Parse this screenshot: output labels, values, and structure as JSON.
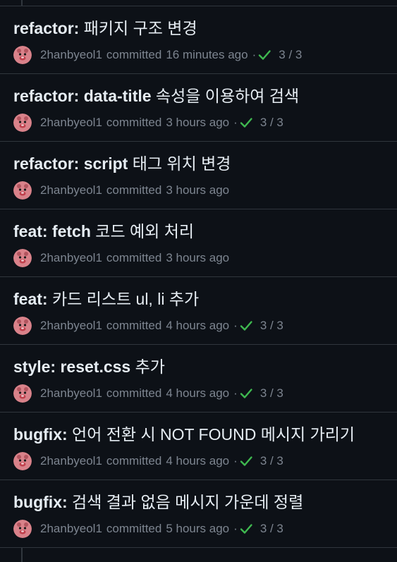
{
  "colors": {
    "background": "#0d1117",
    "border": "#30363d",
    "title_text": "#e6edf3",
    "meta_text": "#7d8590",
    "check_green": "#3fb950"
  },
  "commits": [
    {
      "prefix": "refactor:",
      "message": " 패키지 구조 변경",
      "author": "2hanbyeol1",
      "verb": "committed",
      "time": "16 minutes ago",
      "status": "3 / 3"
    },
    {
      "prefix": "refactor: data-title",
      "message": " 속성을 이용하여 검색",
      "author": "2hanbyeol1",
      "verb": "committed",
      "time": "3 hours ago",
      "status": "3 / 3"
    },
    {
      "prefix": "refactor: script",
      "message": " 태그 위치 변경",
      "author": "2hanbyeol1",
      "verb": "committed",
      "time": "3 hours ago",
      "status": ""
    },
    {
      "prefix": "feat: fetch",
      "message": " 코드 예외 처리",
      "author": "2hanbyeol1",
      "verb": "committed",
      "time": "3 hours ago",
      "status": ""
    },
    {
      "prefix": "feat:",
      "message": " 카드 리스트 ul, li 추가",
      "author": "2hanbyeol1",
      "verb": "committed",
      "time": "4 hours ago",
      "status": "3 / 3"
    },
    {
      "prefix": "style: reset.css",
      "message": " 추가",
      "author": "2hanbyeol1",
      "verb": "committed",
      "time": "4 hours ago",
      "status": "3 / 3"
    },
    {
      "prefix": "bugfix:",
      "message": " 언어 전환 시 NOT FOUND 메시지 가리기",
      "author": "2hanbyeol1",
      "verb": "committed",
      "time": "4 hours ago",
      "status": "3 / 3"
    },
    {
      "prefix": "bugfix:",
      "message": " 검색 결과 없음 메시지 가운데 정렬",
      "author": "2hanbyeol1",
      "verb": "committed",
      "time": "5 hours ago",
      "status": "3 / 3"
    }
  ]
}
